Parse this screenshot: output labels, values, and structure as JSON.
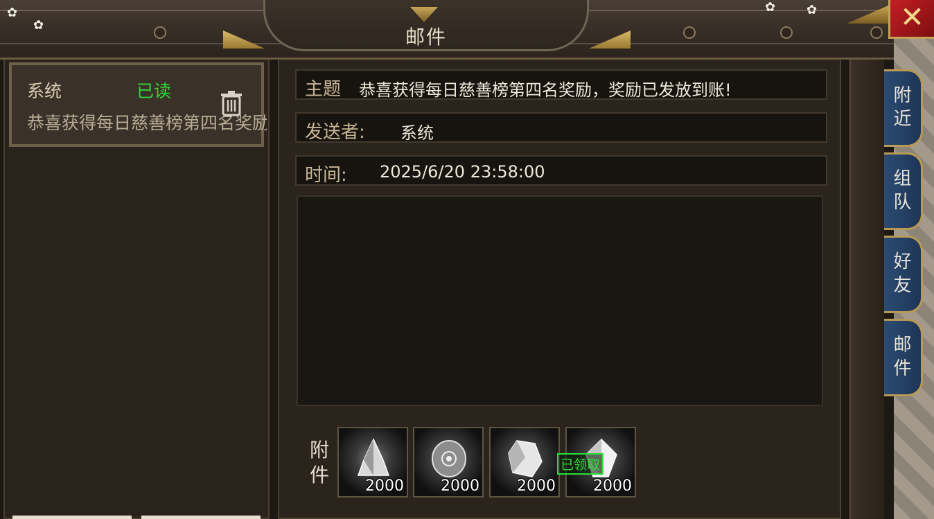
{
  "window": {
    "title": "邮件",
    "close_glyph": "✕"
  },
  "mail_list": {
    "items": [
      {
        "sender": "系统",
        "status": "已读",
        "subject": "恭喜获得每日慈善榜第四名奖励，奖励已发放到账!"
      }
    ]
  },
  "detail": {
    "subject_label": "主题",
    "subject": "恭喜获得每日慈善榜第四名奖励，奖励已发放到账!",
    "sender_label": "发送者:",
    "sender": "系统",
    "time_label": "时间:",
    "time": "2025/6/20 23:58:00",
    "attachments_label_1": "附",
    "attachments_label_2": "件",
    "attachments": [
      {
        "icon": "crystal-shard-icon",
        "qty": "2000",
        "claimed_label": ""
      },
      {
        "icon": "rune-stone-icon",
        "qty": "2000",
        "claimed_label": ""
      },
      {
        "icon": "white-crystal-icon",
        "qty": "2000",
        "claimed_label": ""
      },
      {
        "icon": "glowing-gem-icon",
        "qty": "2000",
        "claimed_label": "已领取"
      }
    ]
  },
  "side_tabs": [
    {
      "line1": "附",
      "line2": "近"
    },
    {
      "line1": "组",
      "line2": "队"
    },
    {
      "line1": "好",
      "line2": "友"
    },
    {
      "line1": "邮",
      "line2": "件"
    }
  ],
  "colors": {
    "read_status": "#2fd83a",
    "tab_blue": "#2c4b72",
    "gold": "#c4a25a"
  }
}
